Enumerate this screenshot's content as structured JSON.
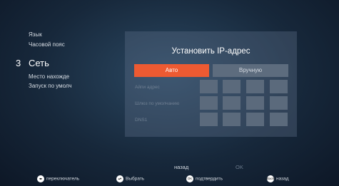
{
  "sidebar": {
    "items": [
      "Язык",
      "Часовой пояс",
      "Место нахожде",
      "Запуск по умолч"
    ],
    "active_number": "3",
    "active_label": "Сеть"
  },
  "dialog": {
    "title": "Установить IP-адрес",
    "auto_label": "Авто",
    "manual_label": "Вручную",
    "field_ip": "Айпи адрес",
    "field_gateway": "Шлюз по умолчанию",
    "field_dns": "DNS1"
  },
  "actions": {
    "back_label": "назад",
    "ok_label": "OK"
  },
  "footer": {
    "toggle": {
      "icon": "left-right-icon",
      "label": "переключатель"
    },
    "select": {
      "icon": "up-down-icon",
      "label": "Выбрать"
    },
    "confirm": {
      "icon": "ok-icon",
      "icon_text": "OK",
      "label": "подтвердить"
    },
    "back": {
      "icon": "back-icon",
      "icon_text": "Back",
      "label": "назад"
    }
  },
  "colors": {
    "accent": "#ed5a32",
    "button_inactive": "#5d6c7e",
    "ip_cell": "#5b6a7c"
  }
}
